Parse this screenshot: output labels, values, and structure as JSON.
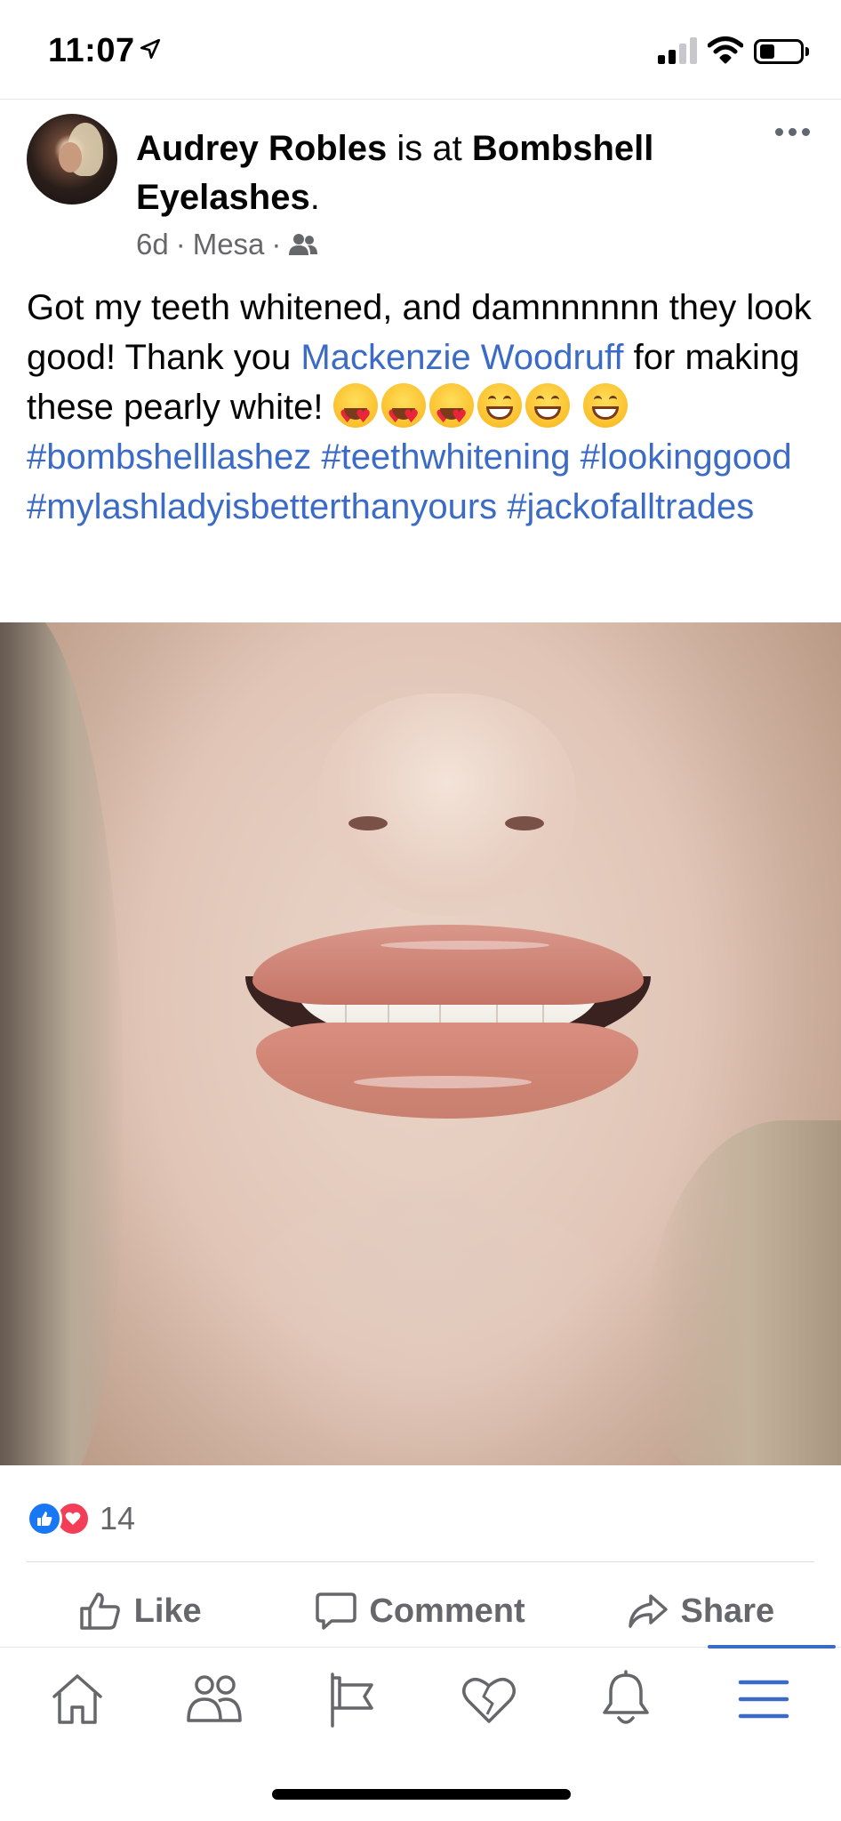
{
  "status_bar": {
    "time": "11:07"
  },
  "post": {
    "author": "Audrey Robles",
    "connector": " is at ",
    "place": "Bombshell Eyelashes",
    "place_suffix": ".",
    "time": "6d",
    "separator": " · ",
    "location": "Mesa",
    "separator2": " ·",
    "privacy_icon": "friends-icon",
    "text_part1": "Got my teeth whitened,  and damnnnnnn they look good! Thank you ",
    "mention": "Mackenzie Woodruff",
    "text_part2": " for making these pearly white! ",
    "emojis_hearts": [
      "heart-eyes-emoji",
      "heart-eyes-emoji",
      "heart-eyes-emoji"
    ],
    "emojis_grins": [
      "grin-emoji",
      "grin-emoji",
      "grin-emoji"
    ],
    "hashtags": [
      "#bombshelllashez",
      "#teethwhitening",
      "#lookinggood",
      "#mylashladyisbetterthanyours",
      "#jackofalltrades"
    ]
  },
  "reactions": {
    "types": [
      "like",
      "love"
    ],
    "count": "14"
  },
  "actions": {
    "like": "Like",
    "comment": "Comment",
    "share": "Share"
  },
  "bottom_nav": {
    "items": [
      "home-icon",
      "friends-icon",
      "pages-flag-icon",
      "dating-heart-icon",
      "notifications-bell-icon",
      "menu-icon"
    ],
    "active": "menu-icon"
  },
  "colors": {
    "link": "#3b6bc6",
    "secondary_text": "#65676b",
    "like_blue": "#1877f2",
    "love_red": "#f33e58"
  }
}
